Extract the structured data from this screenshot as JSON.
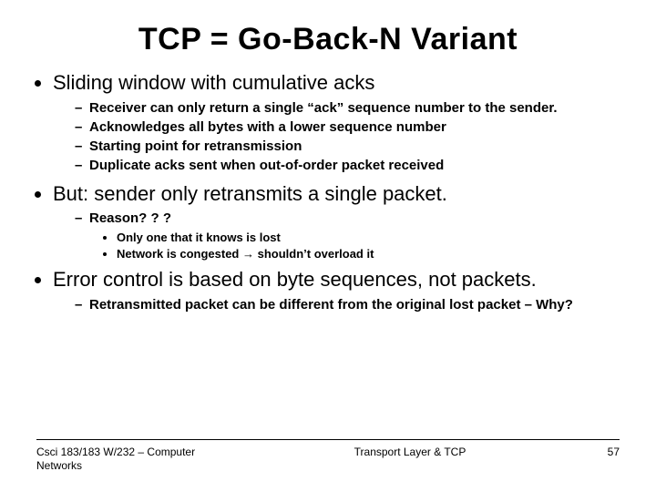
{
  "title": "TCP = Go-Back-N Variant",
  "bullets": {
    "b1": {
      "text": "Sliding window with cumulative acks",
      "sub": {
        "s1": "Receiver can only return a single “ack” sequence number to the sender.",
        "s2": "Acknowledges all bytes with a lower sequence number",
        "s3": "Starting point for retransmission",
        "s4": "Duplicate acks sent when out-of-order packet received"
      }
    },
    "b2": {
      "text": "But: sender only retransmits a single packet.",
      "sub": {
        "s1": "Reason? ? ?",
        "sub2": {
          "r1": "Only one that it knows is lost",
          "r2": "Network is congested → shouldn’t overload it"
        }
      }
    },
    "b3": {
      "text": "Error control is based on byte sequences, not packets.",
      "sub": {
        "s1": "Retransmitted packet can be different from the original lost packet – Why?"
      }
    }
  },
  "footer": {
    "left": "Csci 183/183 W/232 – Computer Networks",
    "center": "Transport Layer & TCP",
    "right": "57"
  }
}
